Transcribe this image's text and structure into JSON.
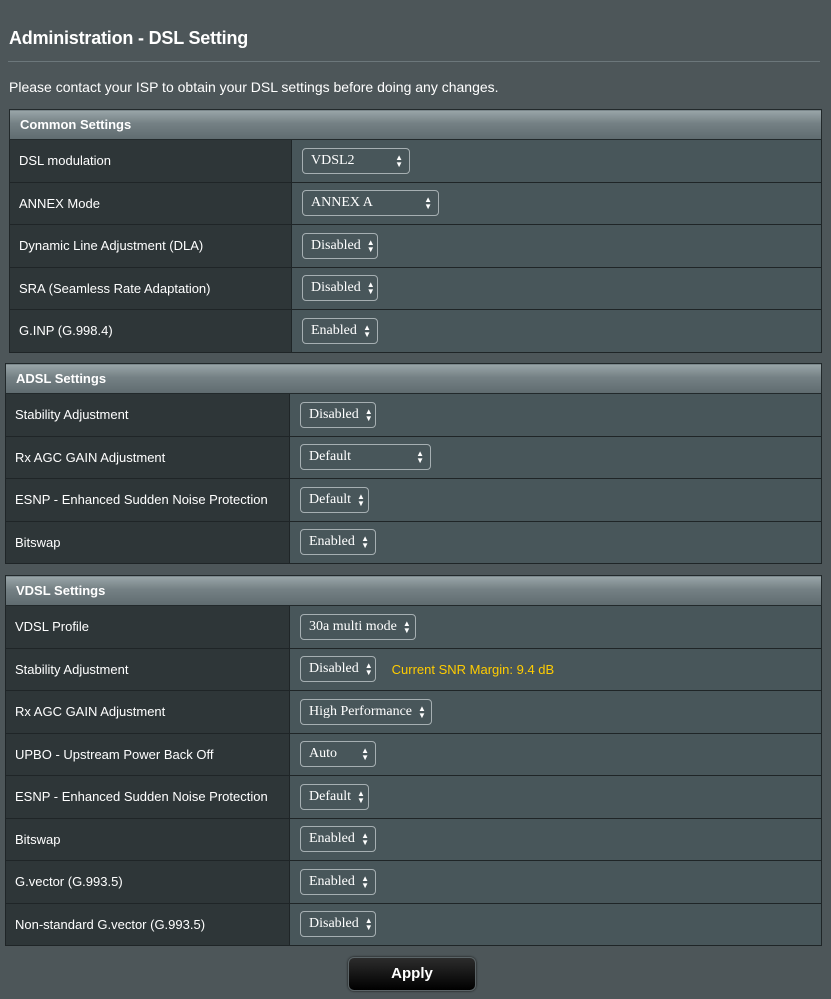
{
  "page": {
    "title": "Administration - DSL Setting",
    "notice": "Please contact your ISP to obtain your DSL settings before doing any changes."
  },
  "common": {
    "header": "Common Settings",
    "rows": [
      {
        "label": "DSL modulation",
        "value": "VDSL2"
      },
      {
        "label": "ANNEX Mode",
        "value": "ANNEX A"
      },
      {
        "label": "Dynamic Line Adjustment (DLA)",
        "value": "Disabled"
      },
      {
        "label": "SRA (Seamless Rate Adaptation)",
        "value": "Disabled"
      },
      {
        "label": "G.INP (G.998.4)",
        "value": "Enabled"
      }
    ]
  },
  "adsl": {
    "header": "ADSL Settings",
    "rows": [
      {
        "label": "Stability Adjustment",
        "value": "Disabled"
      },
      {
        "label": "Rx AGC GAIN Adjustment",
        "value": "Default"
      },
      {
        "label": "ESNP - Enhanced Sudden Noise Protection",
        "value": "Default"
      },
      {
        "label": "Bitswap",
        "value": "Enabled"
      }
    ]
  },
  "vdsl": {
    "header": "VDSL Settings",
    "snr_note": "Current SNR Margin: 9.4 dB",
    "rows": [
      {
        "label": "VDSL Profile",
        "value": "30a multi mode"
      },
      {
        "label": "Stability Adjustment",
        "value": "Disabled"
      },
      {
        "label": "Rx AGC GAIN Adjustment",
        "value": "High Performance"
      },
      {
        "label": "UPBO - Upstream Power Back Off",
        "value": "Auto"
      },
      {
        "label": "ESNP - Enhanced Sudden Noise Protection",
        "value": "Default"
      },
      {
        "label": "Bitswap",
        "value": "Enabled"
      },
      {
        "label": "G.vector (G.993.5)",
        "value": "Enabled"
      },
      {
        "label": "Non-standard G.vector (G.993.5)",
        "value": "Disabled"
      }
    ]
  },
  "actions": {
    "apply_label": "Apply"
  },
  "colors": {
    "background": "#4d5659",
    "label_cell": "#2e3638",
    "value_cell": "#48565a",
    "snr_note": "#ffcc00"
  },
  "icons": {
    "select_arrows": "up-down-arrows-icon"
  }
}
